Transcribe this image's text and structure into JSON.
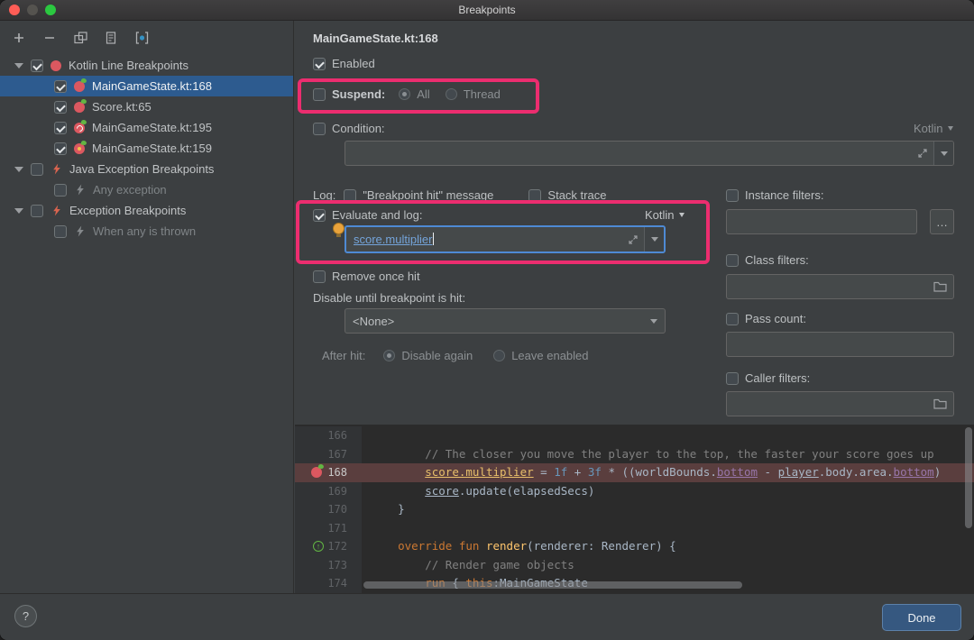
{
  "window": {
    "title": "Breakpoints"
  },
  "colors": {
    "annotation_highlight": "#ec2d6f",
    "selection": "#2d5b8f",
    "breakpoint_line_bg": "#5a3e3e",
    "done_button_bg": "#365880"
  },
  "annotations": {
    "highlighted": [
      "suspend-row",
      "evaluate-and-log-section"
    ]
  },
  "sidebar": {
    "toolbar_icons": [
      "add-icon",
      "remove-icon",
      "group-by-file-icon",
      "move-to-group-icon",
      "group-by-class-icon"
    ],
    "tree": [
      {
        "label": "Kotlin Line Breakpoints",
        "level": 0,
        "expanded": true,
        "checked": true,
        "icon": "breakpoint-group"
      },
      {
        "label": "MainGameState.kt:168",
        "level": 1,
        "checked": true,
        "icon": "breakpoint",
        "selected": true
      },
      {
        "label": "Score.kt:65",
        "level": 1,
        "checked": true,
        "icon": "breakpoint"
      },
      {
        "label": "MainGameState.kt:195",
        "level": 1,
        "checked": true,
        "icon": "breakpoint-suspend"
      },
      {
        "label": "MainGameState.kt:159",
        "level": 1,
        "checked": true,
        "icon": "breakpoint-conditional"
      },
      {
        "label": "Java Exception Breakpoints",
        "level": 0,
        "expanded": true,
        "checked": false,
        "icon": "exception-breakpoint"
      },
      {
        "label": "Any exception",
        "level": 1,
        "checked": false,
        "icon": "exception-breakpoint-muted",
        "muted": true
      },
      {
        "label": "Exception Breakpoints",
        "level": 0,
        "expanded": true,
        "checked": false,
        "icon": "exception-breakpoint"
      },
      {
        "label": "When any is thrown",
        "level": 1,
        "checked": false,
        "icon": "exception-breakpoint-muted",
        "muted": true
      }
    ]
  },
  "detail": {
    "title": "MainGameState.kt:168",
    "enabled": {
      "label": "Enabled",
      "checked": true
    },
    "suspend": {
      "label": "Suspend:",
      "checked": false,
      "option_all": "All",
      "option_thread": "Thread",
      "selected": "All"
    },
    "condition": {
      "label": "Condition:",
      "checked": false,
      "language": "Kotlin",
      "value": ""
    },
    "log": {
      "label": "Log:",
      "message_option": "\"Breakpoint hit\" message",
      "message_checked": false,
      "stack_option": "Stack trace",
      "stack_checked": false
    },
    "evaluate": {
      "label": "Evaluate and log:",
      "checked": true,
      "language": "Kotlin",
      "value": "score.multiplier"
    },
    "remove_once": {
      "label": "Remove once hit",
      "checked": false
    },
    "disable_until": {
      "label": "Disable until breakpoint is hit:",
      "value": "<None>"
    },
    "after_hit": {
      "label": "After hit:",
      "option_disable": "Disable again",
      "option_leave": "Leave enabled",
      "selected": "Disable again"
    },
    "filters": {
      "instance": {
        "label": "Instance filters:",
        "checked": false,
        "value": "",
        "more_button": "…"
      },
      "class": {
        "label": "Class filters:",
        "checked": false,
        "value": ""
      },
      "pass_count": {
        "label": "Pass count:",
        "checked": false,
        "value": ""
      },
      "caller": {
        "label": "Caller filters:",
        "checked": false,
        "value": ""
      }
    }
  },
  "editor": {
    "breakpoint_line": 168,
    "lines": [
      {
        "num": 166,
        "tokens": []
      },
      {
        "num": 167,
        "tokens": [
          {
            "t": "        // The closer you move the player to the top, the faster your score goes up",
            "c": "comment"
          }
        ]
      },
      {
        "num": 168,
        "bp": true,
        "gutter": "breakpoint",
        "tokens": [
          {
            "t": "        ",
            "c": "plain"
          },
          {
            "t": "score.multiplier",
            "c": "eval",
            "u": true
          },
          {
            "t": " = ",
            "c": "plain"
          },
          {
            "t": "1f",
            "c": "number"
          },
          {
            "t": " + ",
            "c": "plain"
          },
          {
            "t": "3f",
            "c": "number"
          },
          {
            "t": " * ((worldBounds.",
            "c": "plain"
          },
          {
            "t": "bottom",
            "c": "field",
            "u": true
          },
          {
            "t": " - ",
            "c": "plain"
          },
          {
            "t": "player",
            "c": "plain",
            "u": true
          },
          {
            "t": ".body.area.",
            "c": "plain"
          },
          {
            "t": "bottom",
            "c": "field",
            "u": true
          },
          {
            "t": ")",
            "c": "plain"
          }
        ]
      },
      {
        "num": 169,
        "tokens": [
          {
            "t": "        ",
            "c": "plain"
          },
          {
            "t": "score",
            "c": "plain",
            "u": true
          },
          {
            "t": ".update(elapsedSecs)",
            "c": "plain"
          }
        ]
      },
      {
        "num": 170,
        "tokens": [
          {
            "t": "    }",
            "c": "plain"
          }
        ]
      },
      {
        "num": 171,
        "tokens": []
      },
      {
        "num": 172,
        "gutter": "override",
        "tokens": [
          {
            "t": "    ",
            "c": "plain"
          },
          {
            "t": "override",
            "c": "keyword"
          },
          {
            "t": " ",
            "c": "plain"
          },
          {
            "t": "fun",
            "c": "keyword"
          },
          {
            "t": " ",
            "c": "plain"
          },
          {
            "t": "render",
            "c": "func"
          },
          {
            "t": "(renderer: Renderer) {",
            "c": "plain"
          }
        ]
      },
      {
        "num": 173,
        "tokens": [
          {
            "t": "        // Render game objects",
            "c": "comment"
          }
        ]
      },
      {
        "num": 174,
        "tokens": [
          {
            "t": "        ",
            "c": "plain"
          },
          {
            "t": "run",
            "c": "keyword"
          },
          {
            "t": " { ",
            "c": "plain"
          },
          {
            "t": "this",
            "c": "keyword"
          },
          {
            "t": ":MainGameState",
            "c": "plain"
          }
        ]
      }
    ]
  },
  "footer": {
    "help": "?",
    "done": "Done"
  }
}
